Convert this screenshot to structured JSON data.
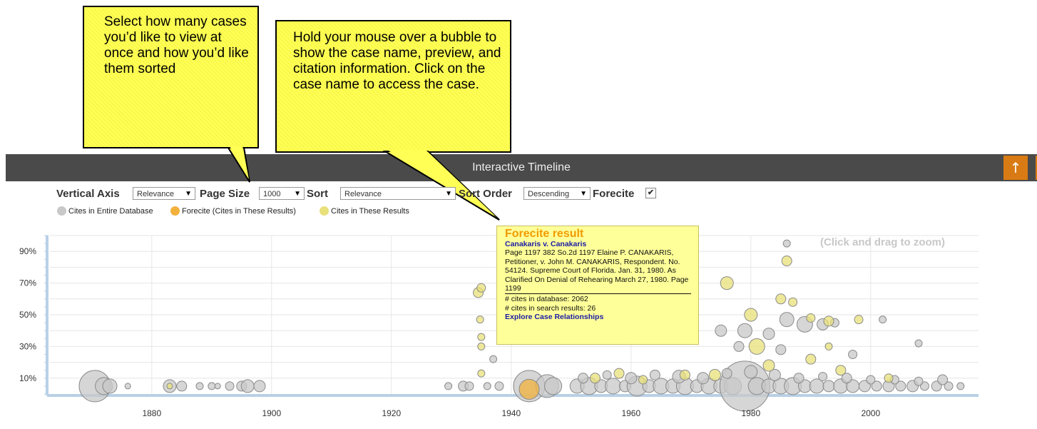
{
  "callouts": {
    "page_size_tip": "Select how many cases you’d like to view at once and how you’d like them sorted",
    "hover_tip": "Hold your mouse over a bubble to show the case name, preview, and citation information. Click on the case name to access the case."
  },
  "header": {
    "title": "Interactive Timeline",
    "up_icon": "arrow-up-icon",
    "down_icon": "arrow-down-icon",
    "up_glyph": "↑",
    "down_glyph": "↓",
    "accent": "#d97b14"
  },
  "controls": {
    "vertical_axis_label": "Vertical Axis",
    "vertical_axis_value": "Relevance",
    "page_size_label": "Page Size",
    "page_size_value": "1000",
    "sort_label": "Sort",
    "sort_value": "Relevance",
    "sort_order_label": "Sort Order",
    "sort_order_value": "Descending",
    "forecite_label": "Forecite",
    "forecite_checked": true
  },
  "legend": {
    "entire_db": "Cites in Entire Database",
    "forecite": "Forecite (Cites in These Results)",
    "these_results": "Cites in These Results",
    "colors": {
      "entire_db": "#c8c8c8",
      "forecite": "#f2b13c",
      "these_results": "#e8e07a"
    }
  },
  "tooltip": {
    "title": "Forecite result",
    "case_name": "Canakaris v. Canakaris",
    "preview": "Page 1197 382 So.2d 1197 Elaine P. CANAKARIS, Petitioner, v. John M. CANAKARIS, Respondent. No. 54124. Supreme Court of Florida. Jan. 31, 1980. As Clarified On Denial of Rehearing March 27, 1980.  Page 1199",
    "cites_db": "# cites in database: 2062",
    "cites_results": "# cites in search results: 26",
    "explore_link": "Explore Case Relationships"
  },
  "chart_data": {
    "type": "scatter",
    "zoom_hint": "(Click and drag to zoom)",
    "x_ticks": [
      "1880",
      "1900",
      "1920",
      "1940",
      "1960",
      "1980",
      "2000"
    ],
    "y_ticks": [
      "10%",
      "30%",
      "50%",
      "70%",
      "90%"
    ],
    "xlim": [
      1863,
      2018
    ],
    "ylim": [
      0,
      100
    ],
    "grid": true,
    "series": [
      {
        "color": "#c8c8c8",
        "points": [
          [
            1870.5,
            5,
            22
          ],
          [
            1872,
            5,
            12
          ],
          [
            1873,
            5,
            10
          ],
          [
            1876,
            5,
            4
          ],
          [
            1883,
            5,
            9
          ],
          [
            1885,
            5,
            7
          ],
          [
            1888,
            5,
            5
          ],
          [
            1890,
            5,
            5
          ],
          [
            1891,
            5,
            4
          ],
          [
            1893,
            5,
            6
          ],
          [
            1895,
            5,
            7
          ],
          [
            1896,
            5,
            9
          ],
          [
            1898,
            5,
            8
          ],
          [
            1929.5,
            5,
            5
          ],
          [
            1932,
            5,
            7
          ],
          [
            1933,
            5,
            6
          ],
          [
            1936,
            5,
            5
          ],
          [
            1938,
            5,
            6
          ],
          [
            1943,
            5,
            22
          ],
          [
            1946,
            5,
            16
          ],
          [
            1947,
            5,
            12
          ],
          [
            1951,
            5,
            10
          ],
          [
            1953,
            5,
            12
          ],
          [
            1955,
            5,
            9
          ],
          [
            1957,
            5,
            11
          ],
          [
            1959,
            5,
            8
          ],
          [
            1961,
            5,
            14
          ],
          [
            1963,
            5,
            9
          ],
          [
            1965,
            5,
            11
          ],
          [
            1967,
            5,
            10
          ],
          [
            1969,
            5,
            12
          ],
          [
            1971,
            5,
            9
          ],
          [
            1973,
            5,
            11
          ],
          [
            1975,
            5,
            10
          ],
          [
            1977,
            5,
            12
          ],
          [
            1979,
            5,
            35
          ],
          [
            1981,
            5,
            12
          ],
          [
            1983,
            5,
            10
          ],
          [
            1985,
            5,
            11
          ],
          [
            1987,
            5,
            12
          ],
          [
            1989,
            5,
            9
          ],
          [
            1991,
            5,
            10
          ],
          [
            1993,
            5,
            8
          ],
          [
            1995,
            5,
            10
          ],
          [
            1997,
            5,
            9
          ],
          [
            1999,
            5,
            8
          ],
          [
            2001,
            5,
            7
          ],
          [
            2003,
            5,
            8
          ],
          [
            2005,
            5,
            7
          ],
          [
            2007,
            5,
            8
          ],
          [
            2009,
            5,
            6
          ],
          [
            2011,
            5,
            7
          ],
          [
            2013,
            5,
            6
          ],
          [
            2015,
            5,
            5
          ],
          [
            1952,
            10,
            7
          ],
          [
            1956,
            12,
            6
          ],
          [
            1960,
            10,
            8
          ],
          [
            1964,
            12,
            7
          ],
          [
            1968,
            11,
            9
          ],
          [
            1972,
            10,
            8
          ],
          [
            1976,
            13,
            7
          ],
          [
            1980,
            14,
            9
          ],
          [
            1984,
            12,
            8
          ],
          [
            1988,
            10,
            7
          ],
          [
            1992,
            11,
            6
          ],
          [
            1996,
            10,
            7
          ],
          [
            2000,
            9,
            6
          ],
          [
            2004,
            9,
            6
          ],
          [
            2008,
            8,
            6
          ],
          [
            2012,
            9,
            7
          ],
          [
            1937,
            22,
            5
          ],
          [
            1975,
            40,
            8
          ],
          [
            1979,
            40,
            10
          ],
          [
            1983,
            38,
            8
          ],
          [
            1986,
            47,
            10
          ],
          [
            1989,
            44,
            11
          ],
          [
            1992,
            44,
            8
          ],
          [
            1994,
            45,
            6
          ],
          [
            2002,
            47,
            5
          ],
          [
            2008,
            32,
            5
          ],
          [
            1986,
            95,
            5
          ],
          [
            1978,
            30,
            7
          ],
          [
            1985,
            28,
            7
          ],
          [
            1997,
            25,
            6
          ]
        ]
      },
      {
        "color": "#e8e07a",
        "points": [
          [
            1934.5,
            64,
            7
          ],
          [
            1935,
            67,
            6
          ],
          [
            1934.8,
            47,
            5
          ],
          [
            1935,
            36,
            5
          ],
          [
            1935,
            30,
            5
          ],
          [
            1935,
            13,
            5
          ],
          [
            1883,
            5,
            4
          ],
          [
            1954,
            10,
            7
          ],
          [
            1962,
            9,
            6
          ],
          [
            1974,
            12,
            8
          ],
          [
            1980,
            50,
            9
          ],
          [
            1981,
            30,
            11
          ],
          [
            1985,
            60,
            7
          ],
          [
            1986,
            84,
            7
          ],
          [
            1987,
            58,
            6
          ],
          [
            1990,
            48,
            6
          ],
          [
            1993,
            46,
            7
          ],
          [
            1993,
            30,
            5
          ],
          [
            1998,
            47,
            6
          ],
          [
            1976,
            70,
            9
          ],
          [
            1983,
            18,
            8
          ],
          [
            1990,
            22,
            7
          ],
          [
            1995,
            15,
            7
          ],
          [
            2003,
            10,
            6
          ],
          [
            1969,
            12,
            7
          ],
          [
            1958,
            13,
            7
          ]
        ]
      },
      {
        "color": "#f2b13c",
        "points": [
          [
            1943,
            3,
            14
          ]
        ]
      }
    ]
  }
}
